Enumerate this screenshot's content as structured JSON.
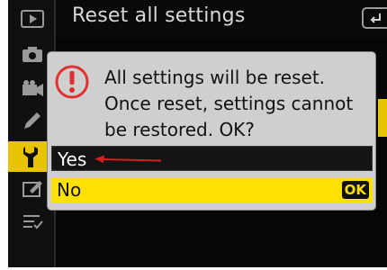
{
  "header": {
    "title": "Reset all settings",
    "back_icon": "back-icon"
  },
  "sidebar": {
    "items": [
      {
        "icon": "playback-icon",
        "active": false
      },
      {
        "icon": "photo-shooting-icon",
        "active": false
      },
      {
        "icon": "movie-shooting-icon",
        "active": false
      },
      {
        "icon": "custom-settings-pencil-icon",
        "active": false
      },
      {
        "icon": "setup-wrench-icon",
        "active": true
      },
      {
        "icon": "retouch-icon",
        "active": false
      },
      {
        "icon": "my-menu-icon",
        "active": false
      }
    ]
  },
  "dialog": {
    "message": "All settings will be reset. Once reset, settings cannot be restored. OK?",
    "icon": "warning-icon",
    "options": [
      {
        "label": "Yes",
        "selected": false
      },
      {
        "label": "No",
        "selected": true,
        "badge": "OK"
      }
    ]
  },
  "colors": {
    "accent": "#ffe000",
    "dialog_bg": "#cfcfcf",
    "warning": "#e03030",
    "annotation_arrow": "#d42020"
  }
}
